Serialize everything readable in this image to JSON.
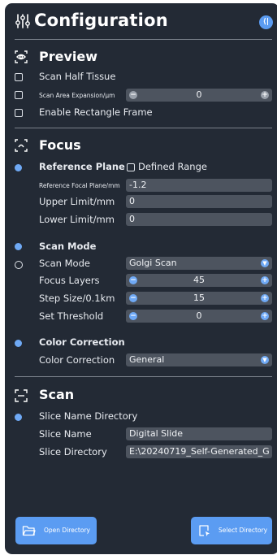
{
  "header": {
    "title": "Configuration",
    "collapse_glyph": "⟨|"
  },
  "preview": {
    "title": "Preview",
    "scan_half_tissue": "Scan Half Tissue",
    "scan_area_expansion": "Scan Area Expansion/μm",
    "scan_area_expansion_value": "0",
    "enable_rectangle_frame": "Enable Rectangle Frame"
  },
  "focus": {
    "title": "Focus",
    "reference_plane": "Reference Plane",
    "defined_range": "Defined Range",
    "reference_focal_plane": "Reference Focal Plane/mm",
    "reference_focal_plane_value": "-1.2",
    "upper_limit": "Upper Limit/mm",
    "upper_limit_value": "0",
    "lower_limit": "Lower Limit/mm",
    "lower_limit_value": "0",
    "scan_mode_header": "Scan Mode",
    "scan_mode": "Scan Mode",
    "scan_mode_value": "Golgi Scan",
    "focus_layers": "Focus Layers",
    "focus_layers_value": "45",
    "step_size": "Step Size/0.1km",
    "step_size_value": "15",
    "set_threshold": "Set Threshold",
    "set_threshold_value": "0",
    "color_correction_header": "Color Correction",
    "color_correction": "Color Correction",
    "color_correction_value": "General"
  },
  "scan": {
    "title": "Scan",
    "slice_name_directory": "Slice Name Directory",
    "slice_name": "Slice Name",
    "slice_name_value": "Digital Slide",
    "slice_directory": "Slice Directory",
    "slice_directory_value": "E:\\20240719_Self-Generated_G"
  },
  "footer": {
    "open_directory": "Open Directory",
    "select_directory": "Select Directory"
  },
  "colors": {
    "panel": "#232a35",
    "accent": "#5b9cf2",
    "field": "#4d545f"
  }
}
